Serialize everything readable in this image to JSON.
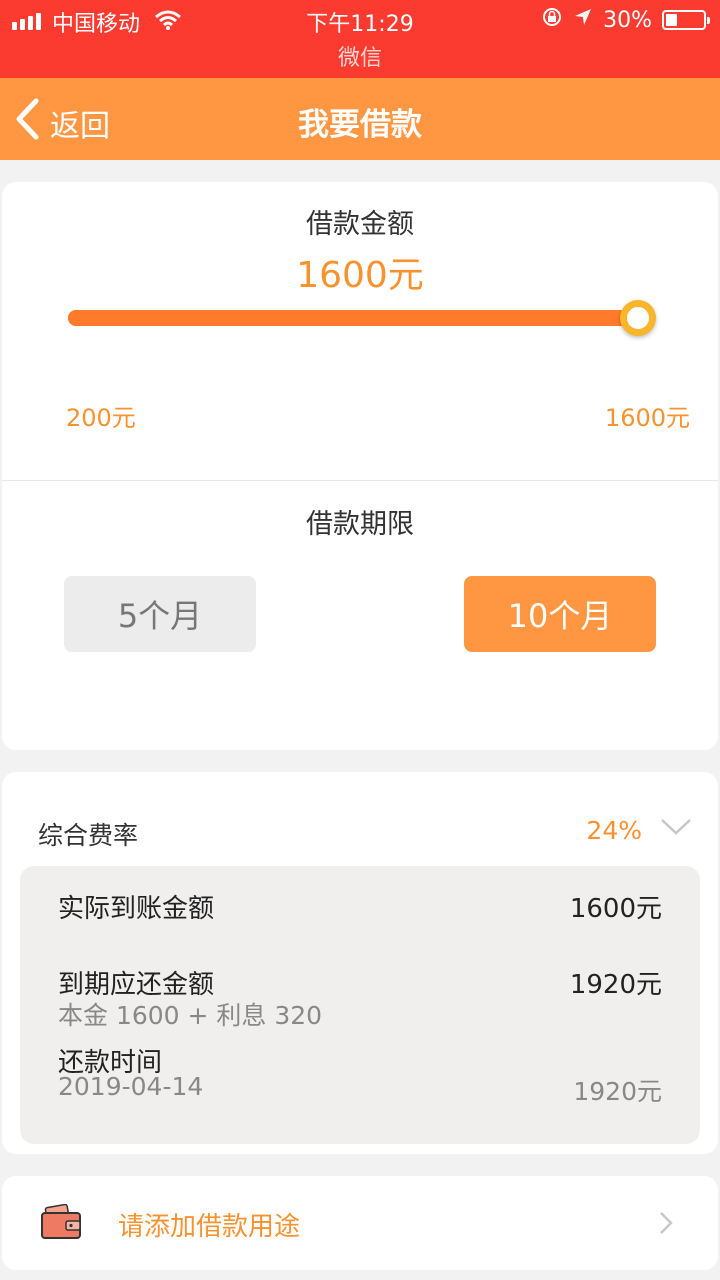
{
  "status_bar": {
    "carrier": "中国移动",
    "time": "下午11:29",
    "battery_text": "30%",
    "battery_level": 0.3,
    "subtitle": "微信"
  },
  "nav": {
    "back_label": "返回",
    "title": "我要借款"
  },
  "loan_amount": {
    "label": "借款金额",
    "value_text": "1600元",
    "slider_value": 1600,
    "slider_min": 200,
    "slider_max": 1600,
    "min_label": "200元",
    "max_label": "1600元"
  },
  "loan_term": {
    "label": "借款期限",
    "options": [
      {
        "label": "5个月",
        "selected": false
      },
      {
        "label": "10个月",
        "selected": true
      }
    ]
  },
  "rate": {
    "label": "综合费率",
    "value": "24%"
  },
  "details": {
    "received_label": "实际到账金额",
    "received_value": "1600元",
    "due_label": "到期应还金额",
    "due_value": "1920元",
    "due_breakdown": "本金 1600 + 利息 320",
    "repay_label": "还款时间",
    "repay_date": "2019-04-14",
    "repay_amount": "1920元"
  },
  "purpose": {
    "label": "请添加借款用途"
  },
  "colors": {
    "status_bar": "#fb3b30",
    "nav_bar": "#ff9642",
    "accent": "#f7922f",
    "slider": "#ff7a2a"
  }
}
